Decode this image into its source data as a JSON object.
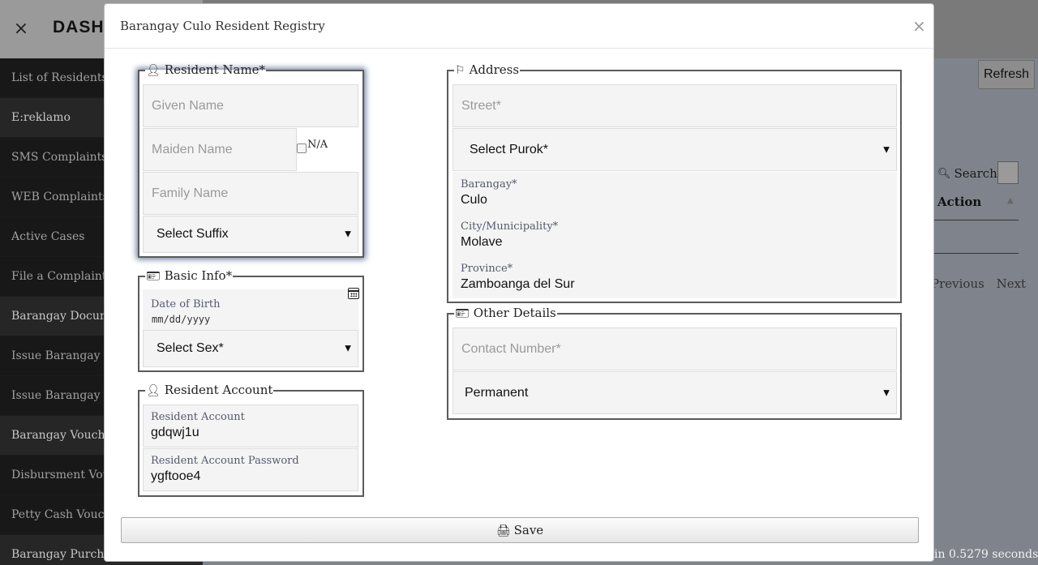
{
  "app": {
    "title": "DASH",
    "close_icon": "×",
    "sidebar": {
      "items": [
        {
          "label": "List of Residents",
          "section": false
        },
        {
          "label": "E:reklamo",
          "section": true
        },
        {
          "label": "SMS Complaints",
          "section": false
        },
        {
          "label": "WEB Complaints",
          "section": false
        },
        {
          "label": "Active Cases",
          "section": false
        },
        {
          "label": "File a Complaint",
          "section": false
        },
        {
          "label": "Barangay Documents",
          "section": true
        },
        {
          "label": "Issue Barangay Clearance",
          "section": false
        },
        {
          "label": "Issue Barangay Certification",
          "section": false
        },
        {
          "label": "Barangay Vouchers",
          "section": true
        },
        {
          "label": "Disbursment Voucher",
          "section": false
        },
        {
          "label": "Petty Cash Voucher",
          "section": false
        },
        {
          "label": "Barangay Purchases",
          "section": true
        }
      ]
    },
    "refresh_label": "Refresh",
    "search_label": "Search:",
    "search_icon": "magnifier-icon",
    "table_header_action": "Action",
    "pager": {
      "previous": "Previous",
      "next": "Next"
    },
    "footer_note": "in 0.5279 seconds."
  },
  "modal": {
    "title": "Barangay Culo Resident Registry",
    "close_icon": "×",
    "resident_name": {
      "legend": "Resident Name*",
      "given_placeholder": "Given Name",
      "maiden_placeholder": "Maiden Name",
      "na_label": "N/A",
      "na_checked": false,
      "family_placeholder": "Family Name",
      "suffix_selected": "Select Suffix"
    },
    "basic_info": {
      "legend": "Basic Info*",
      "dob_label": "Date of Birth",
      "dob_placeholder": "mm/dd/yyyy",
      "sex_selected": "Select Sex*"
    },
    "resident_account": {
      "legend": "Resident Account",
      "account_label": "Resident Account",
      "account_value": "gdqwj1u",
      "password_label": "Resident Account Password",
      "password_value": "ygftooe4"
    },
    "address": {
      "legend": "Address",
      "street_placeholder": "Street*",
      "purok_selected": "Select Purok*",
      "barangay_label": "Barangay*",
      "barangay_value": "Culo",
      "city_label": "City/Municipality*",
      "city_value": "Molave",
      "province_label": "Province*",
      "province_value": "Zamboanga del Sur"
    },
    "other_details": {
      "legend": "Other Details",
      "contact_placeholder": "Contact Number*",
      "residency_selected": "Permanent"
    },
    "save_label": "Save"
  },
  "colors": {
    "sidebar_bg": "#111111",
    "modal_bg": "#ffffff",
    "field_bg": "#f4f4f4",
    "fieldset_border": "#5b5b5b"
  }
}
